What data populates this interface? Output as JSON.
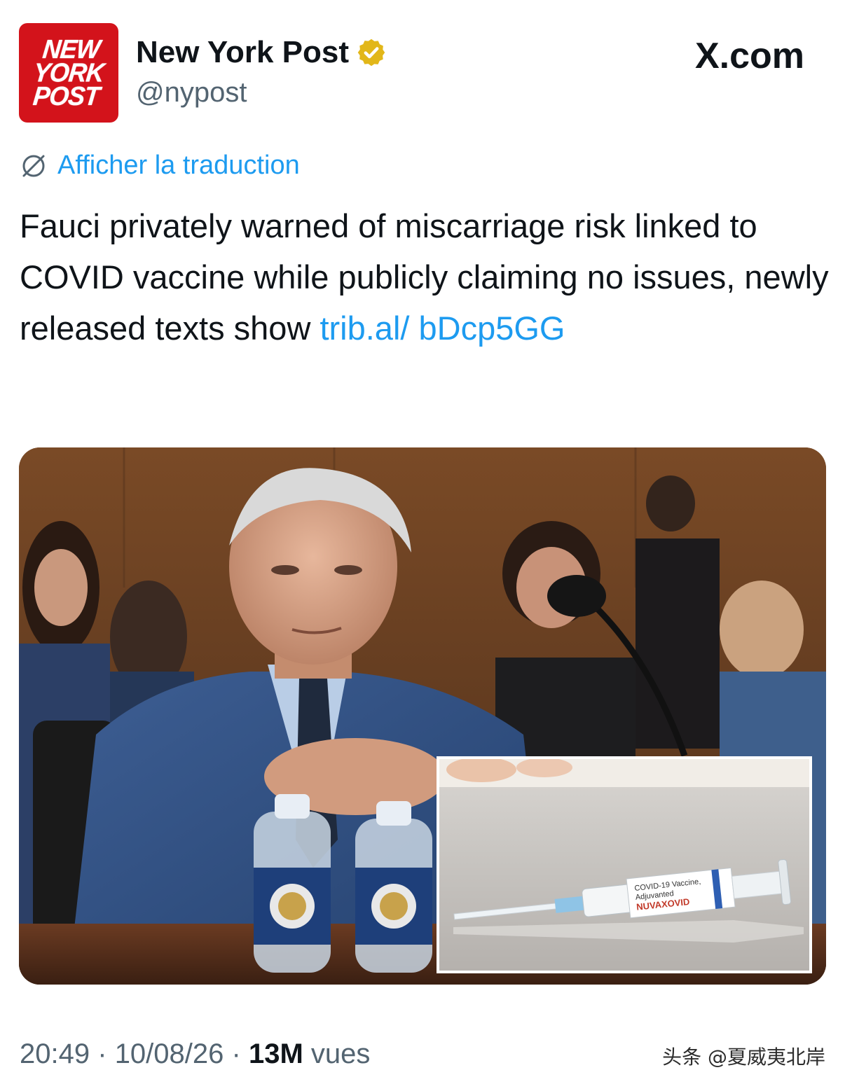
{
  "header": {
    "avatar_lines": [
      "NEW",
      "YORK",
      "POST"
    ],
    "display_name": "New York Post",
    "handle": "@nypost",
    "platform": "X.com"
  },
  "translate_label": "Afficher la traduction",
  "tweet": {
    "text": "Fauci privately warned of miscarriage risk linked to COVID vaccine while publicly claiming no issues, newly released texts show ",
    "link": "trib.al/ bDcp5GG"
  },
  "media": {
    "inset_label_line1": "COVID-19 Vaccine,",
    "inset_label_line2": "Adjuvanted",
    "inset_label_brand": "NUVAXOVID"
  },
  "footer": {
    "time": "20:49",
    "separator": "·",
    "date": "10/08/26",
    "views_count": "13M",
    "views_label": "vues",
    "watermark": "头条 @夏威夷北岸"
  },
  "colors": {
    "brand_red": "#d3131b",
    "link_blue": "#1d9bf0",
    "verified_gold": "#e2b719",
    "muted": "#536471"
  }
}
